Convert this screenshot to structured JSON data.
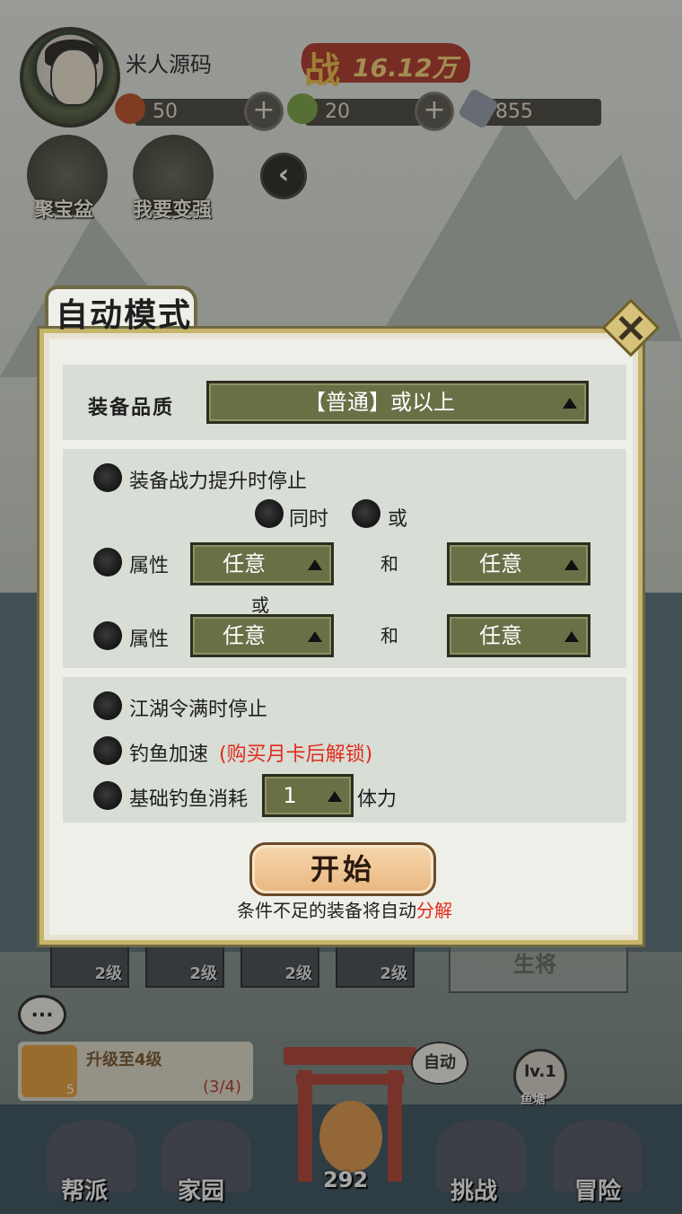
{
  "player": {
    "name": "米人源码",
    "power_label": "战",
    "power_value": "16.12万"
  },
  "resources": {
    "res1": "50",
    "res2": "20",
    "res3": "855"
  },
  "side_buttons": {
    "treasure": "聚宝盆",
    "stronger": "我要变强"
  },
  "modal": {
    "title": "自动模式",
    "quality_label": "装备品质",
    "quality_value": "【普通】或以上",
    "stop_on_power_up": "装备战力提升时停止",
    "mode_and": "同时",
    "mode_or": "或",
    "attr_label_1": "属性",
    "attr_label_2": "属性",
    "attr1_a": "任意",
    "attr1_b": "任意",
    "attr2_a": "任意",
    "attr2_b": "任意",
    "and_1": "和",
    "and_2": "和",
    "or_between": "或",
    "stop_on_token_full": "江湖令满时停止",
    "fishing_speed": "钓鱼加速",
    "fishing_speed_locked": "(购买月卡后解锁)",
    "base_cost_label": "基础钓鱼消耗",
    "base_cost_value": "1",
    "stamina_label": "体力",
    "start_button": "开始",
    "hint_prefix": "条件不足的装备将自动",
    "hint_highlight": "分解"
  },
  "skills": {
    "s1": "2级",
    "s2": "2级",
    "s3": "2级",
    "s4": "2级"
  },
  "general": "生将",
  "chat_icon": "...",
  "quest": {
    "title": "升级至4级",
    "count": "5",
    "progress": "(3/4)"
  },
  "auto_label": "自动",
  "pond": {
    "level": "lv.1",
    "label": "鱼塘"
  },
  "fish_count": "292",
  "nav": {
    "guild": "帮派",
    "home": "家园",
    "challenge": "挑战",
    "adventure": "冒险"
  },
  "colors": {
    "accent_red": "#e22a1c",
    "dropdown_green": "#6a6f46",
    "panel_bg": "#efefe9"
  }
}
